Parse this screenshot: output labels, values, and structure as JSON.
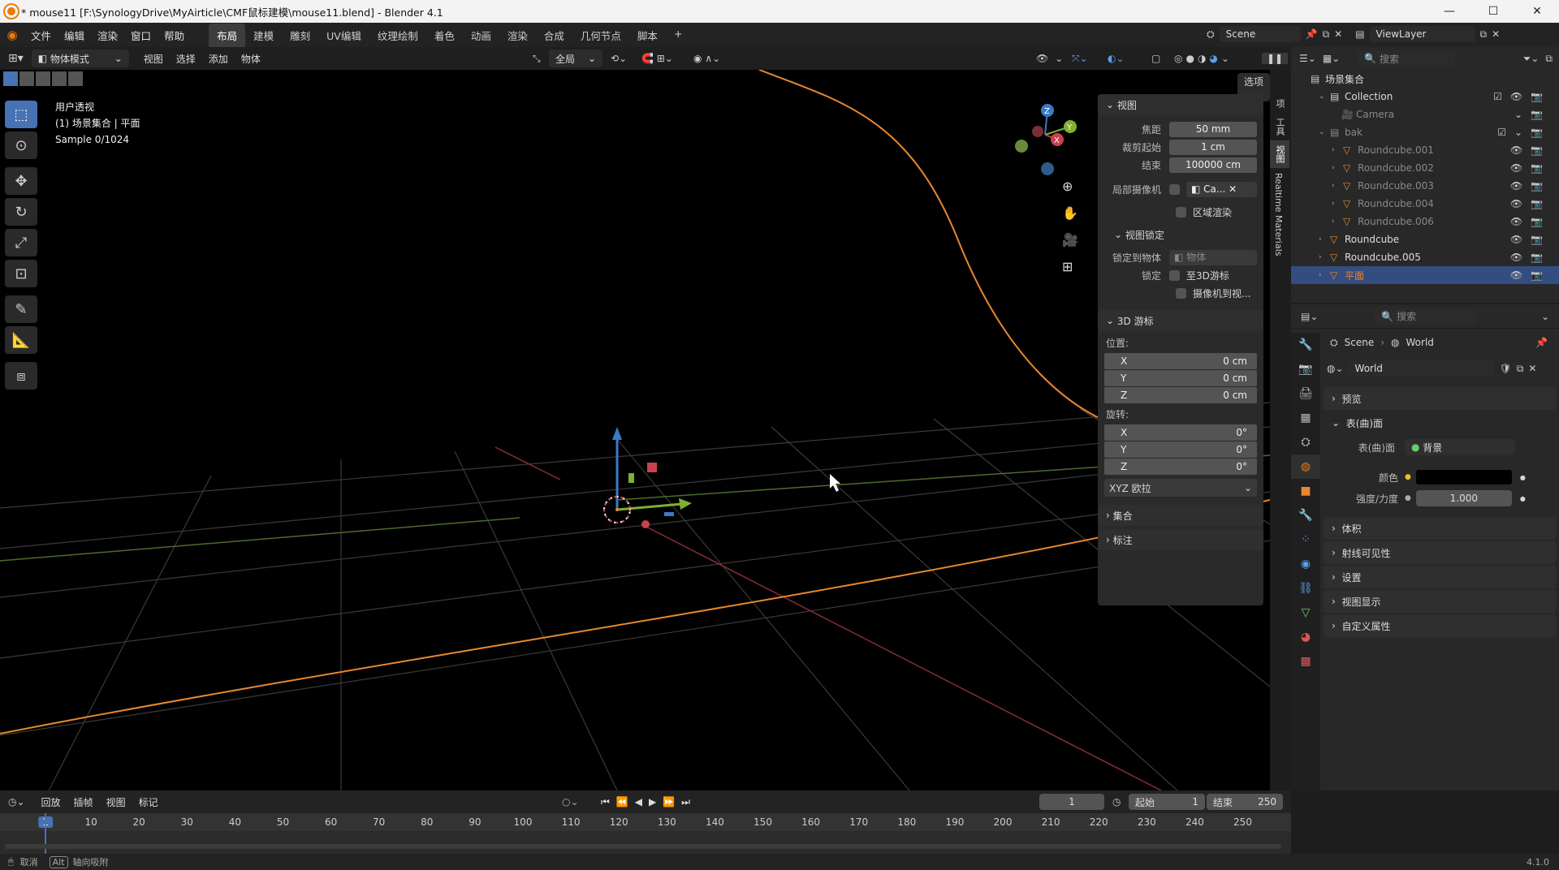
{
  "window": {
    "title": "* mouse11 [F:\\SynologyDrive\\MyAirticle\\CMF鼠标建模\\mouse11.blend] - Blender 4.1",
    "controls": [
      "—",
      "☐",
      "✕"
    ]
  },
  "menu": [
    "文件",
    "编辑",
    "渲染",
    "窗口",
    "帮助"
  ],
  "workspaces": [
    "布局",
    "建模",
    "雕刻",
    "UV编辑",
    "纹理绘制",
    "着色",
    "动画",
    "渲染",
    "合成",
    "几何节点",
    "脚本",
    "+"
  ],
  "active_workspace": "布局",
  "scene": {
    "label": "Scene"
  },
  "view_layer": {
    "label": "ViewLayer"
  },
  "viewport_header": {
    "mode": "物体模式",
    "menus": [
      "视图",
      "选择",
      "添加",
      "物体"
    ],
    "transform_orientation": "全局",
    "options_label": "选项"
  },
  "viewport": {
    "overlay_lines": [
      "用户透视",
      "(1) 场景集合 | 平面",
      "Sample 0/1024"
    ],
    "gizmo_axes": [
      "Z",
      "X",
      "Y"
    ]
  },
  "npanel": {
    "view_section": "视图",
    "focal_label": "焦距",
    "focal_value": "50 mm",
    "clip_start_label": "裁剪起始",
    "clip_start_value": "1 cm",
    "clip_end_label": "结束",
    "clip_end_value": "100000 cm",
    "local_camera_label": "局部摄像机",
    "local_camera_value": "Ca...",
    "region_render": "区域渲染",
    "view_lock_section": "视图锁定",
    "lock_to_object_label": "锁定到物体",
    "lock_to_object_placeholder": "物体",
    "lock_label": "锁定",
    "lock_3d_cursor": "至3D游标",
    "lock_camera": "摄像机到视...",
    "cursor_section": "3D 游标",
    "location_label": "位置:",
    "loc_x": "0 cm",
    "loc_y": "0 cm",
    "loc_z": "0 cm",
    "rotation_label": "旋转:",
    "rot_x": "0°",
    "rot_y": "0°",
    "rot_z": "0°",
    "rotation_mode": "XYZ 欧拉",
    "collection_section": "集合",
    "annotation_section": "标注",
    "axis_x": "X",
    "axis_y": "Y",
    "axis_z": "Z",
    "tabs": [
      "项",
      "工具",
      "视图",
      "Realtime Materials"
    ]
  },
  "outliner": {
    "search_placeholder": "搜索",
    "root": "场景集合",
    "items": [
      {
        "name": "Collection",
        "level": 1
      },
      {
        "name": "Camera",
        "level": 2
      },
      {
        "name": "bak",
        "level": 1
      },
      {
        "name": "Roundcube.001",
        "level": 2
      },
      {
        "name": "Roundcube.002",
        "level": 2
      },
      {
        "name": "Roundcube.003",
        "level": 2
      },
      {
        "name": "Roundcube.004",
        "level": 2
      },
      {
        "name": "Roundcube.006",
        "level": 2
      },
      {
        "name": "Roundcube",
        "level": 1
      },
      {
        "name": "Roundcube.005",
        "level": 1
      },
      {
        "name": "平面",
        "level": 1
      }
    ]
  },
  "properties": {
    "search_placeholder": "搜索",
    "breadcrumb_scene": "Scene",
    "breadcrumb_world": "World",
    "world_name": "World",
    "sections": [
      "预览",
      "表(曲)面",
      "体积",
      "射线可见性",
      "设置",
      "视图显示",
      "自定义属性"
    ],
    "surface_label": "表(曲)面",
    "surface_value": "背景",
    "color_label": "颜色",
    "strength_label": "强度/力度",
    "strength_value": "1.000"
  },
  "timeline": {
    "menus": [
      "回放",
      "插帧",
      "视图",
      "标记"
    ],
    "current_frame": "1",
    "start_label": "起始",
    "start_value": "1",
    "end_label": "结束",
    "end_value": "250",
    "ticks": [
      "1",
      "10",
      "20",
      "30",
      "40",
      "50",
      "60",
      "70",
      "80",
      "90",
      "100",
      "110",
      "120",
      "130",
      "140",
      "150",
      "160",
      "170",
      "180",
      "190",
      "200",
      "210",
      "220",
      "230",
      "240",
      "250"
    ]
  },
  "status": {
    "cancel": "取消",
    "alt_key": "Alt",
    "axis_snap": "轴向吸附",
    "version": "4.1.0"
  },
  "colors": {
    "accent": "#4772b3",
    "selection": "#334d80",
    "orange": "#e8872e",
    "x_axis": "#c8414e",
    "y_axis": "#7fb030",
    "z_axis": "#3a7ac8"
  }
}
